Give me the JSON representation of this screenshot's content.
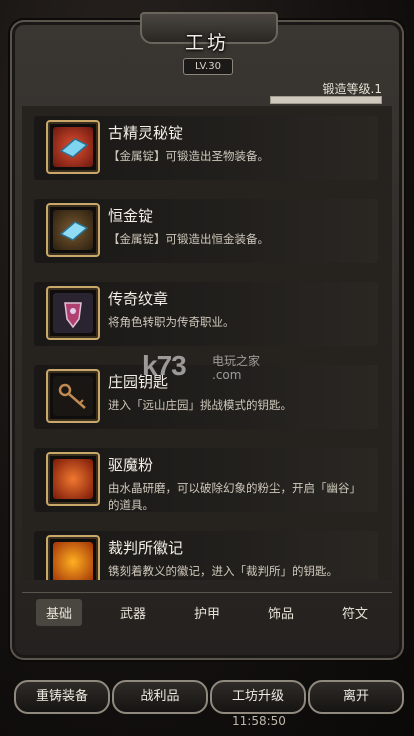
{
  "header": {
    "title": "工坊",
    "level": "LV.30"
  },
  "forge": {
    "label": "锻造等级.1",
    "progress": 1.0
  },
  "items": [
    {
      "name": "古精灵秘锭",
      "desc": "【金属锭】可锻造出圣物装备。",
      "icon": "ingot-icon",
      "color": "#b8402a"
    },
    {
      "name": "恒金锭",
      "desc": "【金属锭】可锻造出恒金装备。",
      "icon": "ingot-icon",
      "color": "#6a5030"
    },
    {
      "name": "传奇纹章",
      "desc": "将角色转职为传奇职业。",
      "icon": "crest-icon",
      "color": "#3a3048"
    },
    {
      "name": "庄园钥匙",
      "desc": "进入「远山庄园」挑战模式的钥匙。",
      "icon": "key-icon",
      "color": "#2a2420"
    },
    {
      "name": "驱魔粉",
      "desc": "由水晶研磨，可以破除幻象的粉尘，开启「幽谷」的道具。",
      "icon": "powder-icon",
      "color": "#c2401a"
    },
    {
      "name": "裁判所徽记",
      "desc": "镌刻着教义的徽记，进入「裁判所」的钥匙。",
      "icon": "emblem-icon",
      "color": "#e07a10"
    }
  ],
  "tabs": [
    "基础",
    "武器",
    "护甲",
    "饰品",
    "符文"
  ],
  "buttons": [
    "重铸装备",
    "战利品",
    "工坊升级",
    "离开"
  ],
  "status": {
    "time": "11:58:50"
  },
  "watermark": {
    "logo": "k73",
    "site": "电玩之家",
    "domain": ".com"
  }
}
